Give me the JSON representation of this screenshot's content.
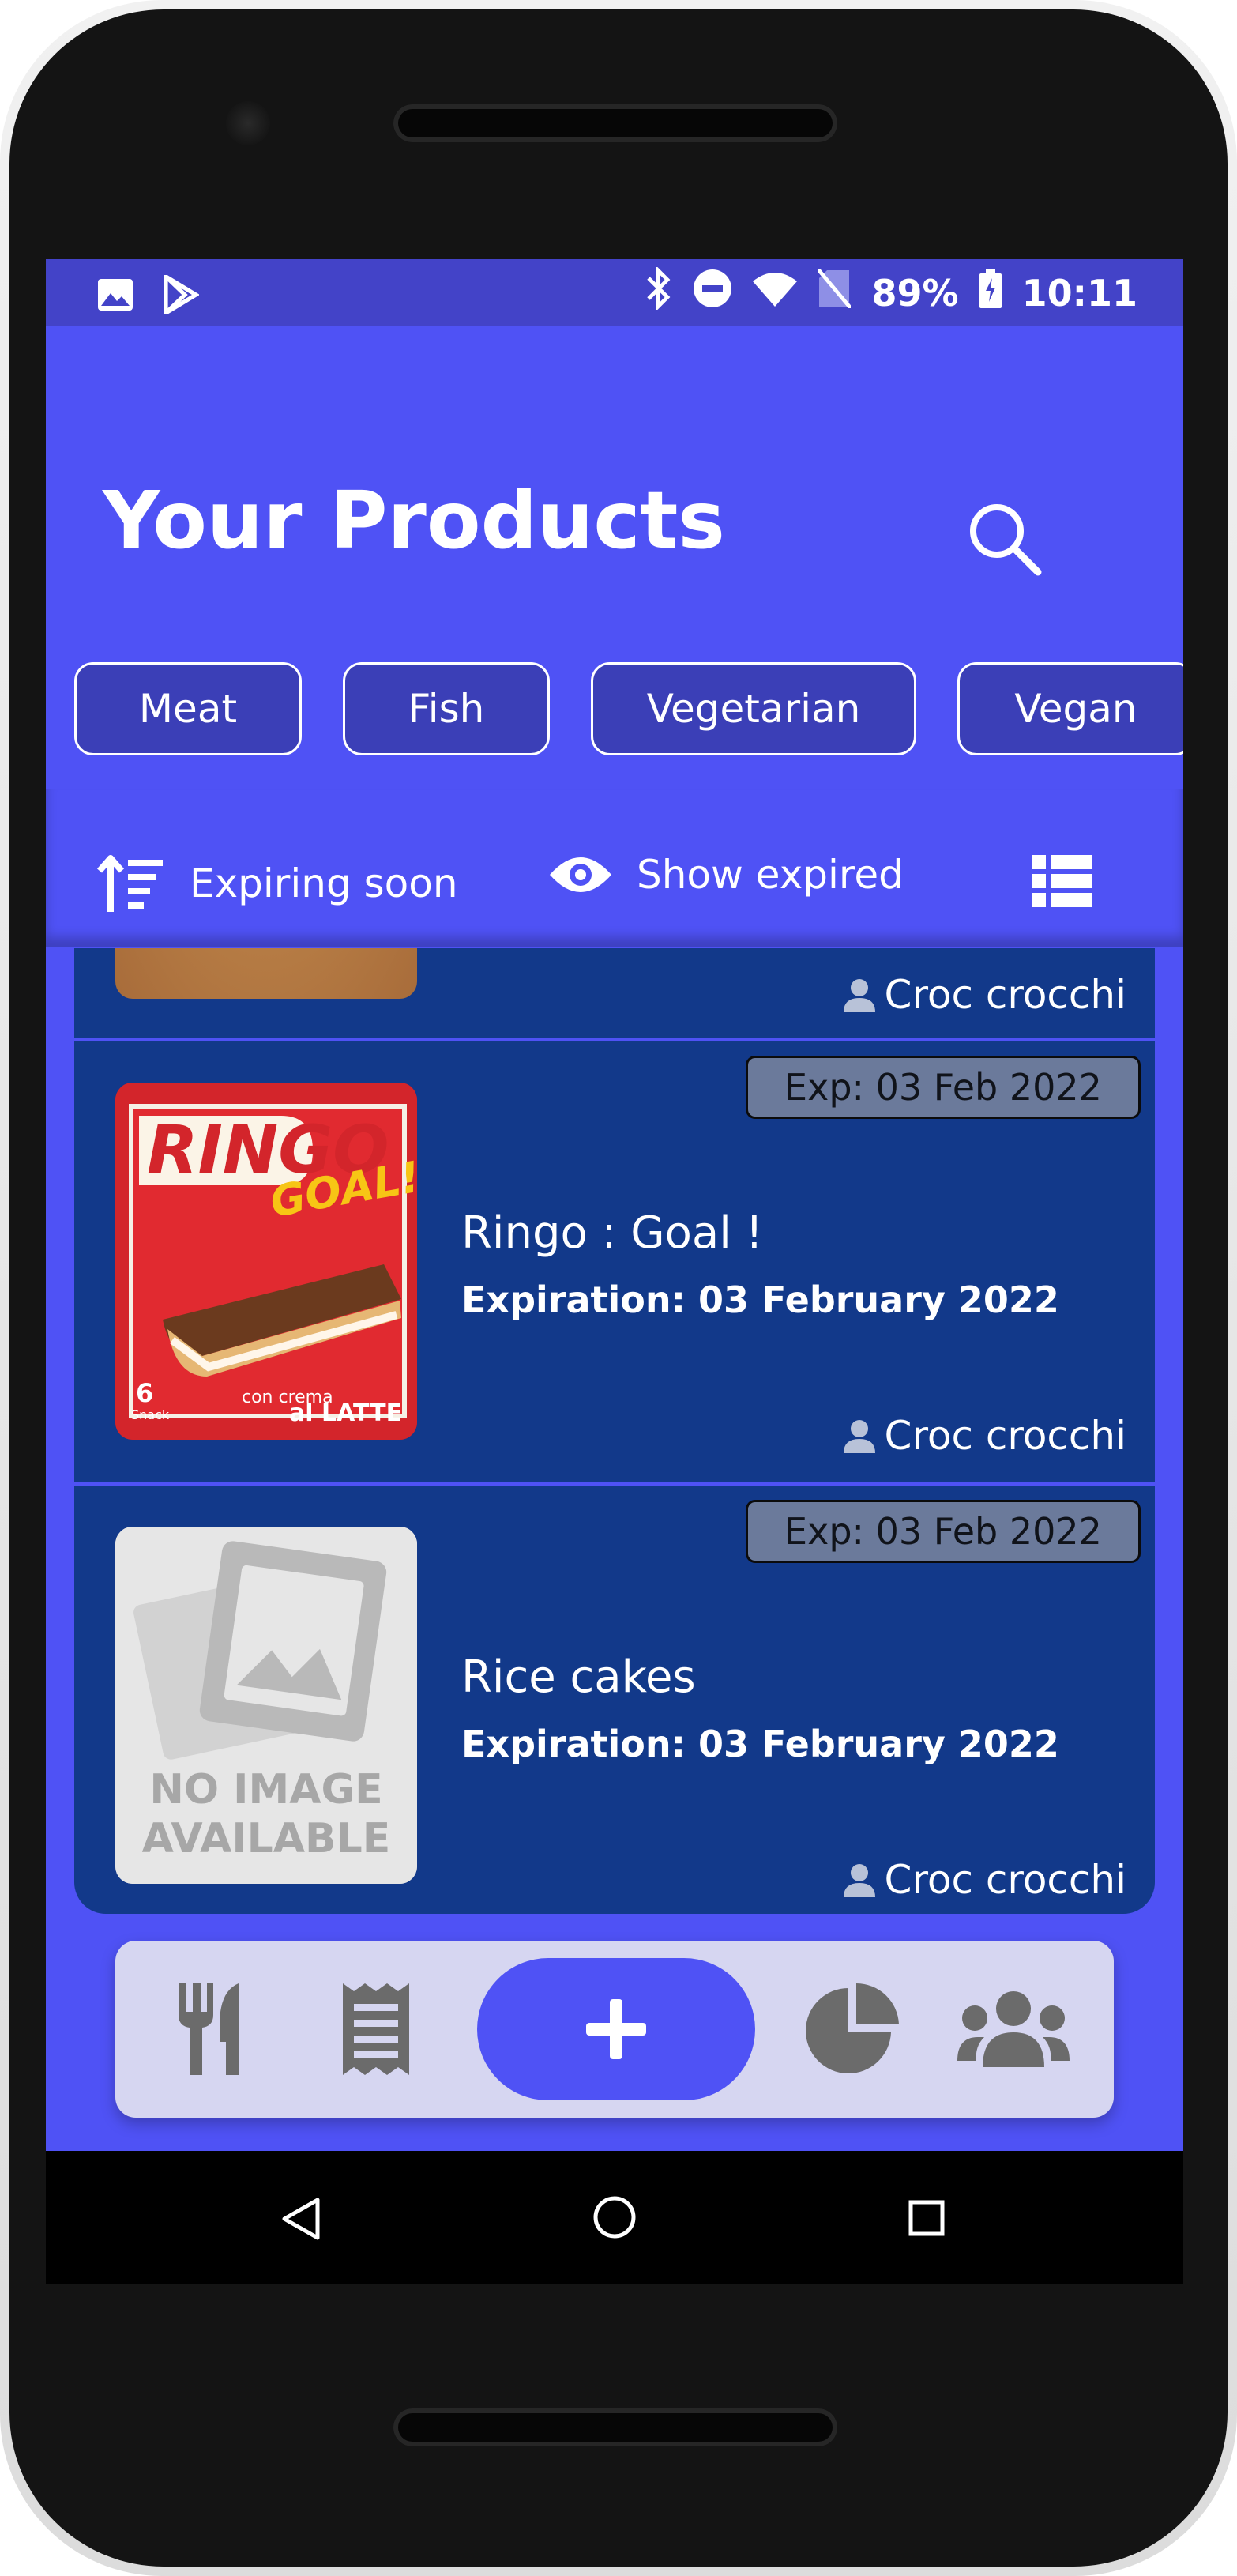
{
  "status_bar": {
    "battery": "89%",
    "time": "10:11"
  },
  "header": {
    "title": "Your Products"
  },
  "categories": [
    "Meat",
    "Fish",
    "Vegetarian",
    "Vegan"
  ],
  "toolbar": {
    "sort_label": "Expiring soon",
    "show_expired_label": "Show expired"
  },
  "products": {
    "partial_owner": "Croc crocchi",
    "items": [
      {
        "badge": "Exp: 03 Feb 2022",
        "name": "Ringo : Goal !",
        "expiration": "Expiration: 03 February 2022",
        "owner": "Croc crocchi",
        "image_text_brand": "RINGO",
        "image_text_sub": "GOAL!",
        "image_count": "6",
        "image_snack": "Snack",
        "image_cream": "con crema",
        "image_milk": "al LATTE"
      },
      {
        "badge": "Exp: 03 Feb 2022",
        "name": "Rice cakes",
        "expiration": "Expiration: 03 February 2022",
        "owner": "Croc crocchi",
        "no_image_line1": "NO IMAGE",
        "no_image_line2": "AVAILABLE"
      }
    ]
  },
  "colors": {
    "primary": "#4f52f5",
    "status_bar": "#4343c8",
    "list_background": "#12398a",
    "chip_background": "#3b3fb7",
    "badge_background": "#6b7a9b",
    "bottom_nav": "#d6d6f1"
  },
  "icons": {
    "status_left": [
      "image-icon",
      "play-store-icon"
    ],
    "status_right": [
      "bluetooth-icon",
      "do-not-disturb-icon",
      "wifi-icon",
      "no-sim-icon",
      "battery-icon"
    ],
    "bottom_nav": [
      "cutlery-icon",
      "receipt-icon",
      "plus-icon",
      "pie-chart-icon",
      "group-icon"
    ],
    "system_nav": [
      "back-icon",
      "home-icon",
      "recents-icon"
    ]
  }
}
